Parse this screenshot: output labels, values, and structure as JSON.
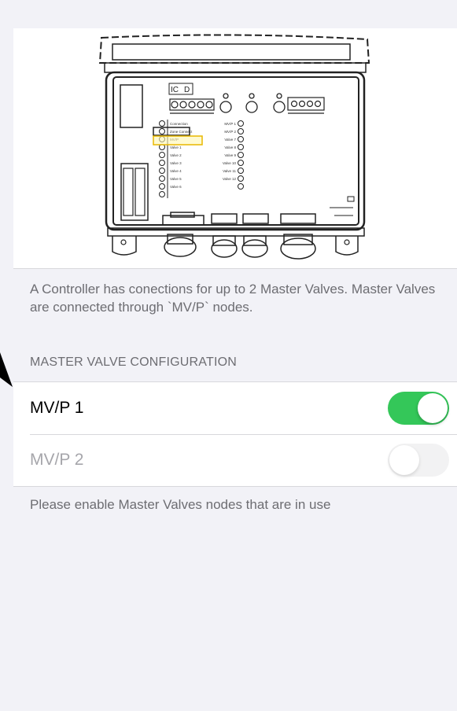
{
  "description": "A Controller has conections for up to 2 Master Valves. Master Valves are connected through `MV/P` nodes.",
  "section_header": "MASTER VALVE CONFIGURATION",
  "rows": [
    {
      "label": "MV/P 1",
      "enabled": true
    },
    {
      "label": "MV/P 2",
      "enabled": false
    }
  ],
  "footer": "Please enable Master Valves nodes that are in use",
  "diagram": {
    "board_labels": [
      "IC",
      "D",
      "Connection",
      "Zone Connect",
      "MV/P",
      "MV/P 1",
      "MV/P 2",
      "Valve 1",
      "Valve 2",
      "Valve 3",
      "Valve 4",
      "Valve 5",
      "Valve 6",
      "Valve 7",
      "Valve 8",
      "Valve 9",
      "Valve 10",
      "Valve 11",
      "Valve 12"
    ]
  },
  "colors": {
    "toggle_on": "#34c759",
    "toggle_off": "#e9e9ea",
    "background": "#f2f2f7"
  }
}
